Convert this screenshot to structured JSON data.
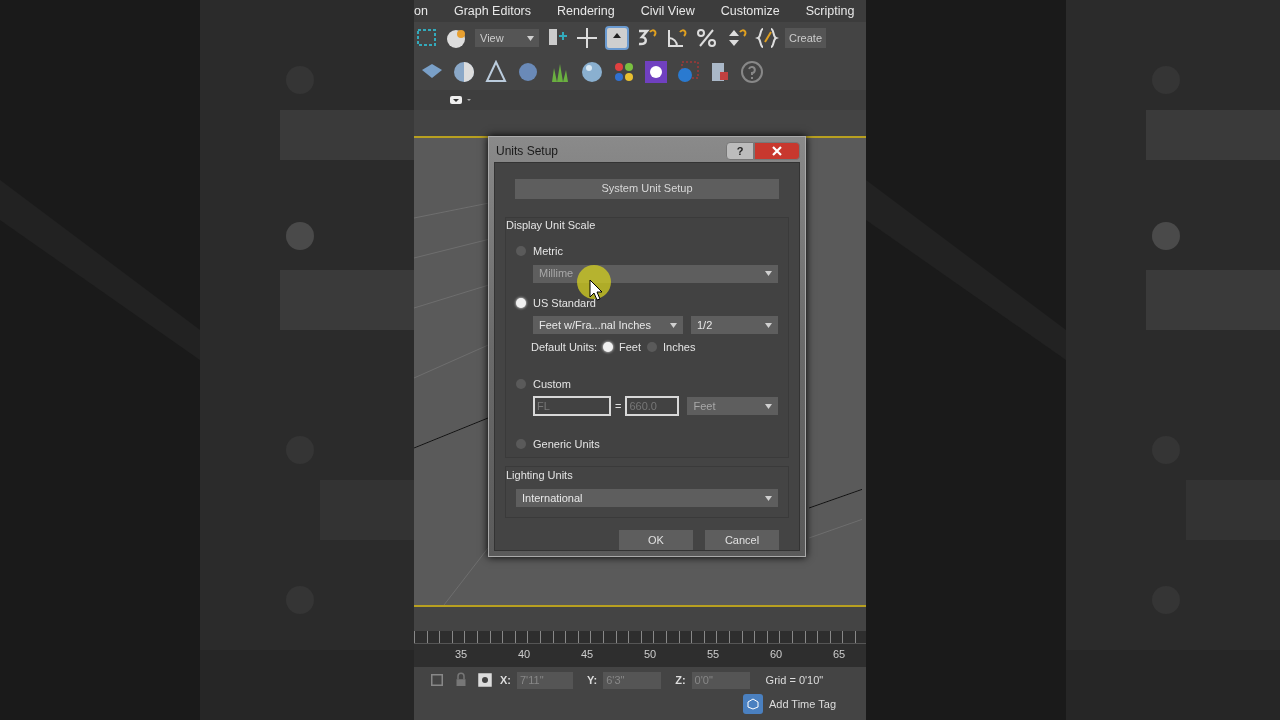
{
  "menu": [
    {
      "label": "on"
    },
    {
      "label": "Graph Editors"
    },
    {
      "label": "Rendering"
    },
    {
      "label": "Civil View"
    },
    {
      "label": "Customize"
    },
    {
      "label": "Scripting"
    }
  ],
  "toolbar": {
    "view_dropdown": "View",
    "create_button": "Create"
  },
  "dialog": {
    "title": "Units Setup",
    "help": "?",
    "system_unit_button": "System Unit Setup",
    "display_unit_scale": {
      "title": "Display Unit Scale",
      "options": [
        {
          "kind": "metric",
          "label": "Metric",
          "selected": false,
          "dropdown": "Millime"
        },
        {
          "kind": "us",
          "label": "US Standard",
          "selected": true,
          "dropdown": "Feet w/Fra...nal Inches",
          "fraction": "1/2",
          "default_units_label": "Default Units:",
          "default_units": [
            {
              "label": "Feet",
              "selected": true
            },
            {
              "label": "Inches",
              "selected": false
            }
          ]
        },
        {
          "kind": "custom",
          "label": "Custom",
          "selected": false,
          "name_value": "FL",
          "equals": "=",
          "amount": "660.0",
          "unit": "Feet"
        },
        {
          "kind": "generic",
          "label": "Generic Units",
          "selected": false
        }
      ]
    },
    "lighting_units": {
      "title": "Lighting Units",
      "value": "International"
    },
    "buttons": [
      "OK",
      "Cancel"
    ]
  },
  "timeline": {
    "ticks": [
      "35",
      "40",
      "45",
      "50",
      "55",
      "60",
      "65"
    ]
  },
  "status": {
    "x_label": "X:",
    "x": "7'11\"",
    "y_label": "Y:",
    "y": "6'3\"",
    "z_label": "Z:",
    "z": "0'0\"",
    "grid": "Grid = 0'10\"",
    "time_tag": "Add Time Tag"
  }
}
